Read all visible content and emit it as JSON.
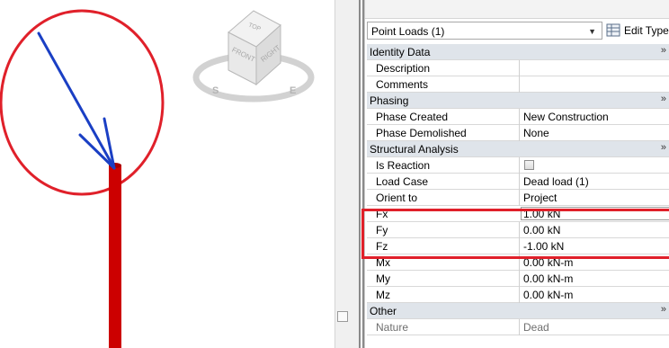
{
  "viewcube": {
    "top_label": "TOP",
    "front_label": "FRONT",
    "right_label": "RIGHT",
    "compass_s": "S",
    "compass_e": "E"
  },
  "palette": {
    "type_selector": "Point Loads (1)",
    "edit_type_label": "Edit Type",
    "categories": {
      "identity": "Identity Data",
      "phasing": "Phasing",
      "structural": "Structural Analysis",
      "other": "Other"
    },
    "params": {
      "description": {
        "name": "Description",
        "value": ""
      },
      "comments": {
        "name": "Comments",
        "value": ""
      },
      "phase_created": {
        "name": "Phase Created",
        "value": "New Construction"
      },
      "phase_demolished": {
        "name": "Phase Demolished",
        "value": "None"
      },
      "is_reaction": {
        "name": "Is Reaction",
        "checked": false
      },
      "load_case": {
        "name": "Load Case",
        "value": "Dead load (1)"
      },
      "orient_to": {
        "name": "Orient to",
        "value": "Project"
      },
      "fx": {
        "name": "Fx",
        "value": "1.00 kN"
      },
      "fy": {
        "name": "Fy",
        "value": "0.00 kN"
      },
      "fz": {
        "name": "Fz",
        "value": "-1.00 kN"
      },
      "mx": {
        "name": "Mx",
        "value": "0.00 kN-m"
      },
      "my": {
        "name": "My",
        "value": "0.00 kN-m"
      },
      "mz": {
        "name": "Mz",
        "value": "0.00 kN-m"
      },
      "nature": {
        "name": "Nature",
        "value": "Dead"
      }
    }
  },
  "colors": {
    "annotation_red": "#e0202a",
    "column_red": "#cc0000",
    "load_arrow_blue": "#1a3fc4",
    "category_bg": "#dfe4ea"
  }
}
